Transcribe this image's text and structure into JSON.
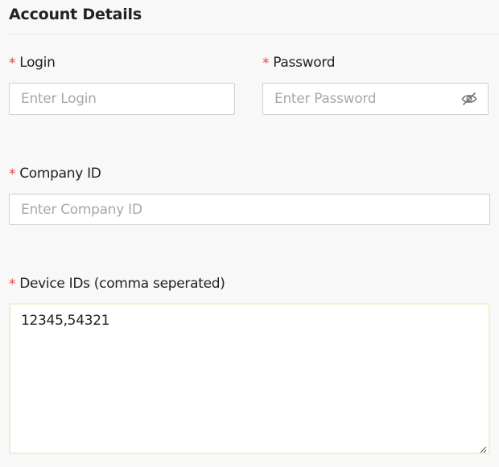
{
  "section": {
    "title": "Account Details"
  },
  "login": {
    "label": "Login",
    "required_mark": "*",
    "placeholder": "Enter Login",
    "value": ""
  },
  "password": {
    "label": "Password",
    "required_mark": "*",
    "placeholder": "Enter Password",
    "value": "",
    "toggle_icon": "eye-slash-icon"
  },
  "company": {
    "label": "Company ID",
    "required_mark": "*",
    "placeholder": "Enter Company ID",
    "value": ""
  },
  "devices": {
    "label": "Device IDs (comma seperated)",
    "required_mark": "*",
    "value": "12345,54321"
  },
  "colors": {
    "required": "#e04848",
    "focus_border": "#e6f5cf",
    "placeholder": "#a8a8a8",
    "border": "#cfcfcf"
  }
}
